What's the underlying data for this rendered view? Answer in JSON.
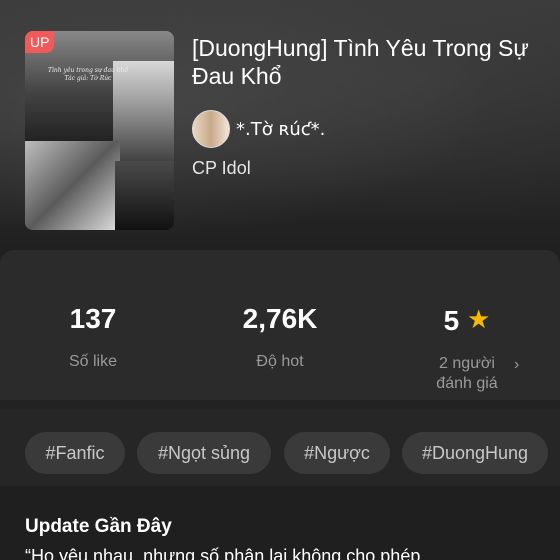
{
  "story": {
    "badge": "UP",
    "title": "[DuongHung] Tình Yêu Trong Sự Đau Khổ",
    "cover_caption": "Tình yêu trong sự đau khổ Tác giả: Tờ Rức",
    "author": "*.Tờ ʀúƈ*.",
    "category": "CP Idol"
  },
  "stats": {
    "likes_value": "137",
    "likes_label": "Số like",
    "hot_value": "2,76K",
    "hot_label": "Độ hot",
    "rating_value": "5",
    "rating_label_1": "2 người",
    "rating_label_2": "đánh giá"
  },
  "tags": [
    "#Fanfic",
    "#Ngọt sủng",
    "#Ngược",
    "#DuongHung"
  ],
  "update": {
    "heading": "Update Gần Đây",
    "excerpt": "“Họ yêu nhau, nhưng số phận lại không cho phép"
  },
  "colors": {
    "badge": "#f05a5a",
    "star": "#f6b800",
    "panel": "#2b2b2b",
    "tag_bg": "#3a3a3a"
  },
  "icons": {
    "star": "star-icon",
    "chevron": "chevron-right-icon"
  }
}
